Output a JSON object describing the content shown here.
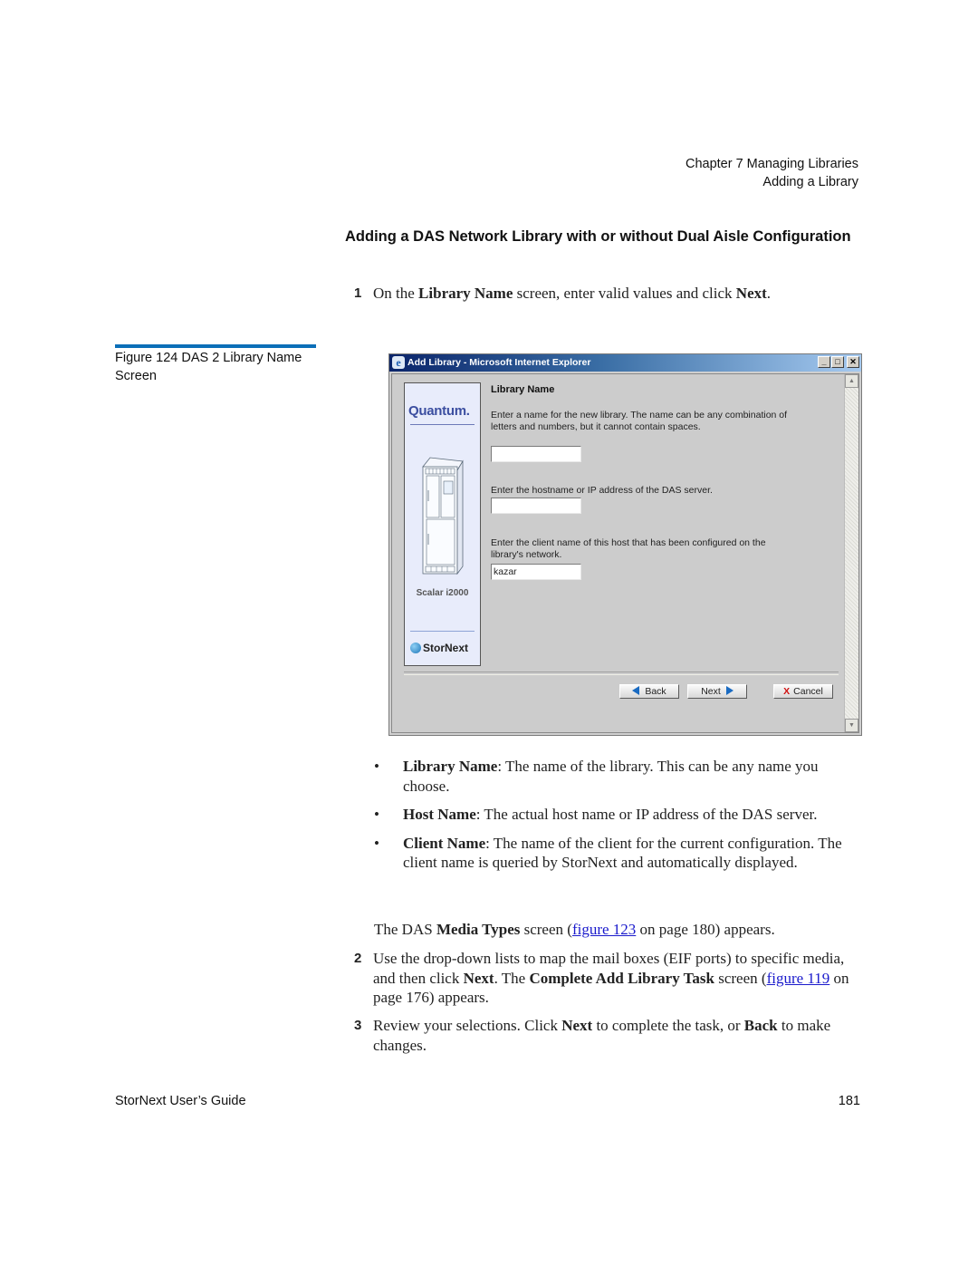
{
  "running_head": {
    "chapter": "Chapter 7  Managing Libraries",
    "section": "Adding a Library"
  },
  "section_title": "Adding a DAS Network Library with or without Dual Aisle Configuration",
  "step1": {
    "number": "1",
    "pre": "On the ",
    "kw1": "Library Name",
    "mid": " screen, enter valid values and click ",
    "kw2": "Next",
    "post": "."
  },
  "figure": {
    "caption": "Figure 124  DAS 2 Library Name Screen"
  },
  "window": {
    "title": "Add Library - Microsoft Internet Explorer",
    "controls": {
      "minimize": "_",
      "maximize": "□",
      "close": "✕"
    },
    "sidepanel": {
      "brand": "Quantum.",
      "product": "Scalar i2000",
      "footer_brand": "StorNext"
    },
    "form": {
      "heading": "Library Name",
      "library_name_label": "Enter a name for the new library. The name can be any combination of letters and numbers, but it cannot contain spaces.",
      "library_name_value": "",
      "host_label": "Enter the hostname or IP address of the DAS server.",
      "host_value": "",
      "client_label": "Enter the client name of this host that has been configured on the library's network.",
      "client_value": "kazar"
    },
    "buttons": {
      "back": "Back",
      "next": "Next",
      "cancel": "Cancel"
    }
  },
  "bullets": [
    {
      "term": "Library Name",
      "text": ": The name of the library. This can be any name you choose."
    },
    {
      "term": "Host Name",
      "text": ": The actual host name or IP address of the DAS server."
    },
    {
      "term": "Client Name",
      "text": ": The name of the client for the current configuration. The client name is queried by StorNext and automatically displayed."
    }
  ],
  "media_types_para": {
    "pre": "The DAS ",
    "kw": "Media Types",
    "mid": " screen (",
    "link": "figure 123",
    "post": " on page 180) appears."
  },
  "step2": {
    "number": "2",
    "pre": "Use the drop-down lists to map the mail boxes (EIF ports) to specific media, and then click ",
    "kw1": "Next",
    "mid": ". The ",
    "kw2": "Complete Add Library Task",
    "mid2": " screen (",
    "link": "figure 119",
    "post": " on page 176) appears."
  },
  "step3": {
    "number": "3",
    "pre": "Review your selections. Click ",
    "kw1": "Next",
    "mid": " to complete the task, or ",
    "kw2": "Back",
    "post": " to make changes."
  },
  "footer": {
    "guide_title": "StorNext User’s Guide",
    "page_number": "181"
  },
  "colors": {
    "figure_rule": "#0b6fb8",
    "link": "#1a1acc",
    "titlebar_start": "#0a246a",
    "titlebar_end": "#a6caf0"
  }
}
